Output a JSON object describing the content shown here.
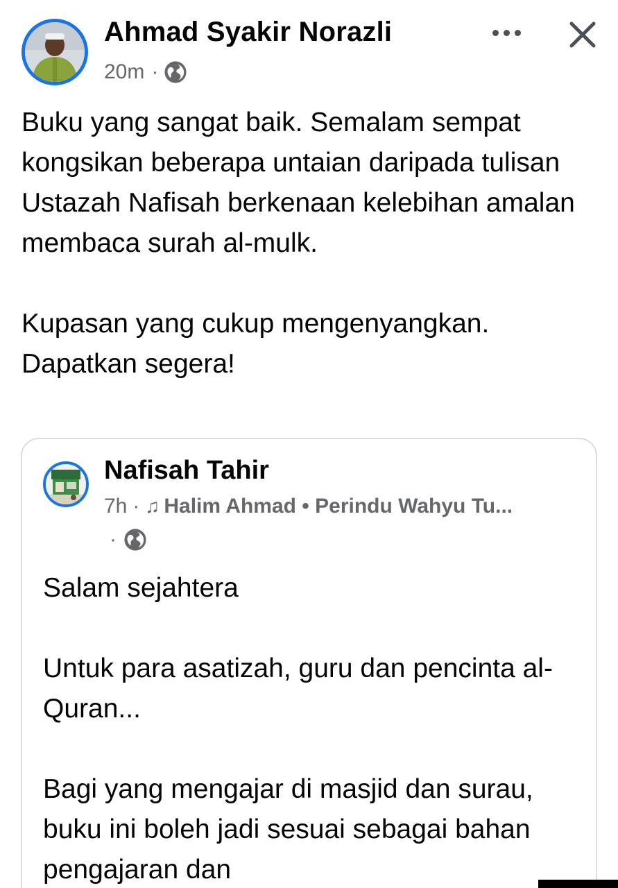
{
  "post": {
    "author": "Ahmad Syakir Norazli",
    "time": "20m",
    "separator": "·",
    "audience_icon": "globe-icon",
    "more_icon": "more-options-icon",
    "close_icon": "close-icon",
    "paragraphs": [
      "Buku yang sangat baik. Semalam sempat kongsikan beberapa untaian daripada tulisan Ustazah Nafisah berkenaan kelebihan amalan membaca surah al-mulk.",
      "Kupasan yang cukup mengenyangkan. Dapatkan segera!"
    ]
  },
  "shared": {
    "author": "Nafisah Tahir",
    "time": "7h",
    "separator": "·",
    "music_icon": "music-note-icon",
    "song": "Halim Ahmad • Perindu Wahyu Tu...",
    "separator2": "·",
    "audience_icon": "globe-icon",
    "paragraphs": [
      "Salam sejahtera",
      "Untuk para asatizah, guru dan pencinta al-Quran...",
      "Bagi yang mengajar di masjid dan surau, buku ini boleh jadi  sesuai sebagai bahan pengajaran dan"
    ]
  },
  "colors": {
    "accent": "#1b74e4",
    "text": "#050505",
    "secondary": "#65676b",
    "border": "#dadde1"
  }
}
